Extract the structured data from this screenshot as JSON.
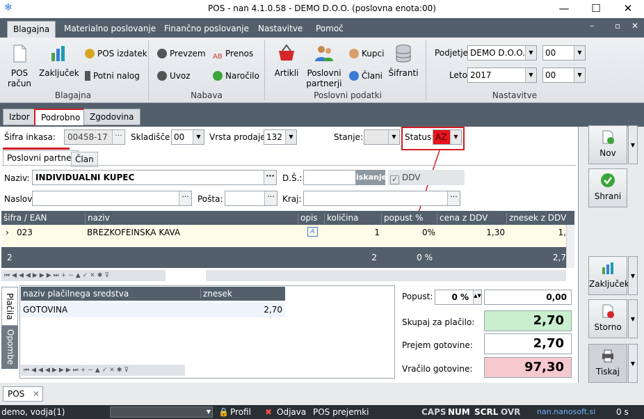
{
  "window": {
    "title": "POS - nan 4.1.0.58 - DEMO D.O.O. (poslovna enota:00)",
    "minimize": "—",
    "maximize": "☐",
    "close": "✕"
  },
  "ribbon_tabs": [
    "Blagajna",
    "Materialno poslovanje",
    "Finančno poslovanje",
    "Nastavitve",
    "Pomoč"
  ],
  "mdi_buttons": [
    "–",
    "▫",
    "✕"
  ],
  "ribbon": {
    "blagajna": {
      "label": "Blagajna",
      "pos_racun": "POS\nračun",
      "zakljucek": "Zaključek",
      "pos_izdatek": "POS izdatek",
      "potni_nalog": "Potni nalog"
    },
    "nabava": {
      "label": "Nabava",
      "prevzem": "Prevzem",
      "uvoz": "Uvoz",
      "prenos": "Prenos",
      "narocilo": "Naročilo"
    },
    "poslovni": {
      "label": "Poslovni podatki",
      "artikli": "Artikli",
      "partnerji": "Poslovni\npartnerji",
      "kupci": "Kupci",
      "clani": "Člani",
      "sifranti": "Šifranti"
    },
    "nastavitve": {
      "label": "Nastavitve",
      "podjetje_label": "Podjetje",
      "podjetje": "DEMO D.O.O.",
      "podjetje_code": "00",
      "leto_label": "Leto",
      "leto": "2017",
      "leto_code": "00"
    }
  },
  "subtabs": [
    "Izbor",
    "Podrobno",
    "Zgodovina"
  ],
  "header": {
    "sifra_label": "Šifra inkasa:",
    "sifra": "00458-17",
    "skladisce_label": "Skladišče:",
    "skladisce": "00",
    "vrsta_label": "Vrsta prodaje:",
    "vrsta": "132",
    "stanje_label": "Stanje:",
    "stanje": "",
    "status_label": "Status:",
    "status": "AZ"
  },
  "partner_tabs": [
    "Poslovni partner",
    "Član"
  ],
  "partner": {
    "naziv_label": "Naziv:",
    "naziv": "INDIVIDUALNI KUPEC",
    "ds_label": "D.Š.:",
    "ds": "",
    "iskanje": "iskanje",
    "ddv_label": "DDV zavezanec",
    "naslov_label": "Naslov:",
    "naslov": "",
    "posta_label": "Pošta:",
    "posta": "",
    "kraj_label": "Kraj:",
    "kraj": ""
  },
  "items_grid": {
    "columns": [
      "šifra / EAN",
      "naziv",
      "opis",
      "količina",
      "popust %",
      "cena z DDV",
      "znesek z DDV"
    ],
    "rows": [
      {
        "sifra": "023",
        "naziv": "BREZKOFEINSKA KAVA",
        "opis_icon": "edit-icon",
        "kolicina": "1",
        "popust": "0%",
        "cena": "1,30",
        "znesek": "1,"
      }
    ],
    "footer": {
      "count": "2",
      "kolicina": "2",
      "popust": "0 %",
      "znesek": "2,7"
    }
  },
  "side_tabs": [
    "Plačila",
    "Opombe"
  ],
  "payments_grid": {
    "columns": [
      "naziv plačilnega sredstva",
      "znesek"
    ],
    "rows": [
      {
        "naziv": "GOTOVINA",
        "znesek": "2,70"
      }
    ]
  },
  "totals": {
    "popust_label": "Popust:",
    "popust_pct": "0 %",
    "popust_amount": "0,00",
    "skupaj_label": "Skupaj za plačilo:",
    "skupaj": "2,70",
    "prejem_label": "Prejem gotovine:",
    "prejem": "2,70",
    "vracilo_label": "Vračilo gotovine:",
    "vracilo": "97,30"
  },
  "side_buttons": {
    "nov": "Nov",
    "shrani": "Shrani",
    "zakljucek": "Zaključek",
    "storno": "Storno",
    "tiskaj": "Tiskaj"
  },
  "doc_tab": "POS",
  "statusbar": {
    "user": "demo, vodja(1)",
    "profil": "Profil",
    "odjava": "Odjava",
    "prejemki": "POS prejemki",
    "caps": "CAPS",
    "num": "NUM",
    "scrl": "SCRL",
    "ovr": "OVR",
    "site": "nan.nanosoft.si",
    "time": "0 s"
  },
  "colors": {
    "accent_red": "#d01c23",
    "dark_bar": "#53606b",
    "green_total": "#c9efcf",
    "pink_total": "#f6c9cf"
  }
}
